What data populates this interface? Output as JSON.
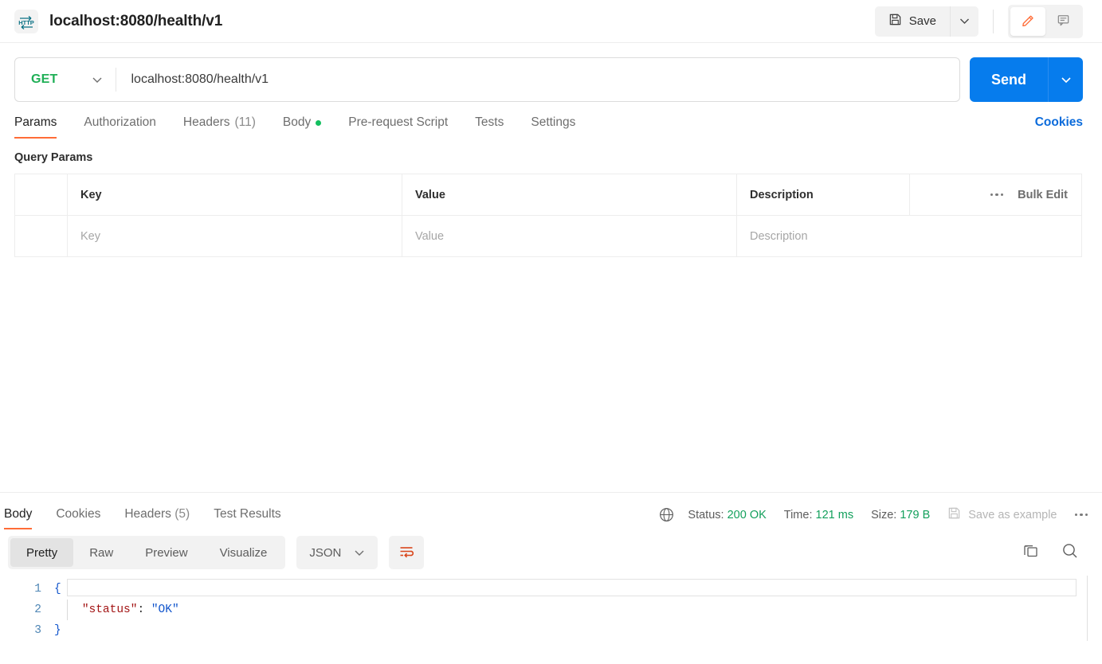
{
  "topbar": {
    "protocol_badge": "HTTP",
    "request_title": "localhost:8080/health/v1",
    "save_label": "Save",
    "save_caret_icon": "chevron-down-icon",
    "edit_icon": "pencil-icon",
    "comment_icon": "comment-icon"
  },
  "url_bar": {
    "method": "GET",
    "method_caret_icon": "chevron-down-icon",
    "url": "localhost:8080/health/v1",
    "send_label": "Send",
    "send_caret_icon": "chevron-down-icon"
  },
  "request_tabs": {
    "items": [
      {
        "label": "Params",
        "count": "",
        "active": true,
        "dot": false
      },
      {
        "label": "Authorization",
        "count": "",
        "active": false,
        "dot": false
      },
      {
        "label": "Headers",
        "count": "(11)",
        "active": false,
        "dot": false
      },
      {
        "label": "Body",
        "count": "",
        "active": false,
        "dot": true
      },
      {
        "label": "Pre-request Script",
        "count": "",
        "active": false,
        "dot": false
      },
      {
        "label": "Tests",
        "count": "",
        "active": false,
        "dot": false
      },
      {
        "label": "Settings",
        "count": "",
        "active": false,
        "dot": false
      }
    ],
    "cookies_label": "Cookies"
  },
  "query_params": {
    "section_title": "Query Params",
    "columns": [
      "",
      "Key",
      "Value",
      "Description"
    ],
    "bulk_edit_label": "Bulk Edit",
    "bulk_menu_icon": "ellipsis-icon",
    "rows": [
      {
        "key": "Key",
        "value": "Value",
        "description": "Description"
      }
    ]
  },
  "response": {
    "tabs": [
      {
        "label": "Body",
        "count": "",
        "active": true
      },
      {
        "label": "Cookies",
        "count": "",
        "active": false
      },
      {
        "label": "Headers",
        "count": "(5)",
        "active": false
      },
      {
        "label": "Test Results",
        "count": "",
        "active": false
      }
    ],
    "globe_icon": "globe-icon",
    "meta": [
      {
        "label": "Status:",
        "value": "200 OK"
      },
      {
        "label": "Time:",
        "value": "121 ms"
      },
      {
        "label": "Size:",
        "value": "179 B"
      }
    ],
    "save_example_label": "Save as example",
    "save_example_icon": "floppy-icon",
    "more_icon": "ellipsis-icon",
    "format_tabs": [
      "Pretty",
      "Raw",
      "Preview",
      "Visualize"
    ],
    "active_format": "Pretty",
    "language": "JSON",
    "language_caret_icon": "chevron-down-icon",
    "wrap_icon": "word-wrap-icon",
    "copy_icon": "copy-icon",
    "search_icon": "search-icon",
    "code_lines": [
      {
        "num": "1",
        "indent": "",
        "punct": "{",
        "key": "",
        "colon": "",
        "str": ""
      },
      {
        "num": "2",
        "indent": "    ",
        "punct": "",
        "key": "\"status\"",
        "colon": ": ",
        "str": "\"OK\""
      },
      {
        "num": "3",
        "indent": "",
        "punct": "}",
        "key": "",
        "colon": "",
        "str": ""
      }
    ]
  },
  "colors": {
    "accent_orange": "#ff6c37",
    "send_blue": "#067ced",
    "link_blue": "#0b6bdb",
    "method_green": "#1faf56",
    "status_green": "#13a05c",
    "body_dot_green": "#13bf5f",
    "json_key_red": "#a31515",
    "json_string_blue": "#1155cc"
  }
}
